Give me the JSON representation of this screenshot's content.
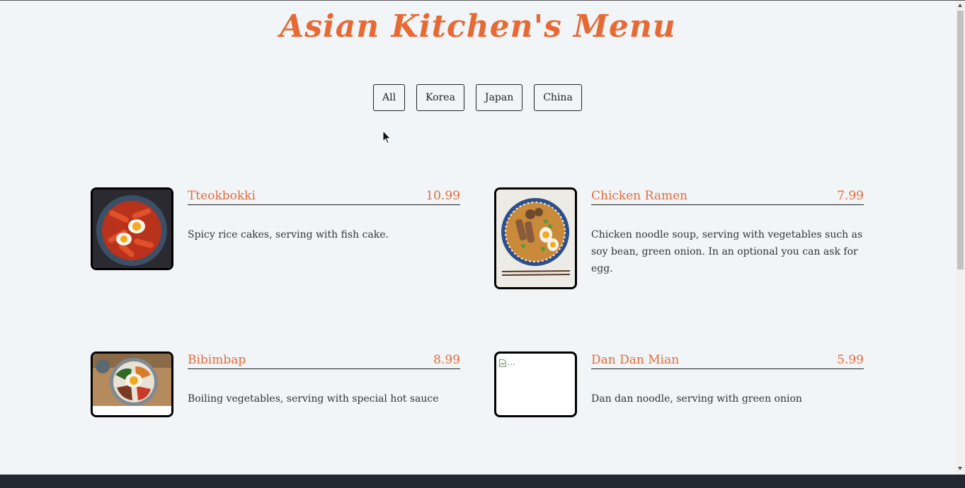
{
  "page": {
    "title": "Asian Kitchen's Menu"
  },
  "filters": [
    "All",
    "Korea",
    "Japan",
    "China"
  ],
  "menu": [
    {
      "name": "Tteokbokki",
      "price": "10.99",
      "desc": "Spicy rice cakes, serving with fish cake."
    },
    {
      "name": "Chicken Ramen",
      "price": "7.99",
      "desc": "Chicken noodle soup, serving with vegetables such as soy bean, green onion. In an optional you can ask for egg."
    },
    {
      "name": "Bibimbap",
      "price": "8.99",
      "desc": "Boiling vegetables, serving with special hot sauce"
    },
    {
      "name": "Dan Dan Mian",
      "price": "5.99",
      "desc": "Dan dan noodle, serving with green onion",
      "img_alt": "..."
    }
  ],
  "colors": {
    "accent": "#e76a35",
    "background": "#f1f5f8",
    "footer": "#232830"
  }
}
